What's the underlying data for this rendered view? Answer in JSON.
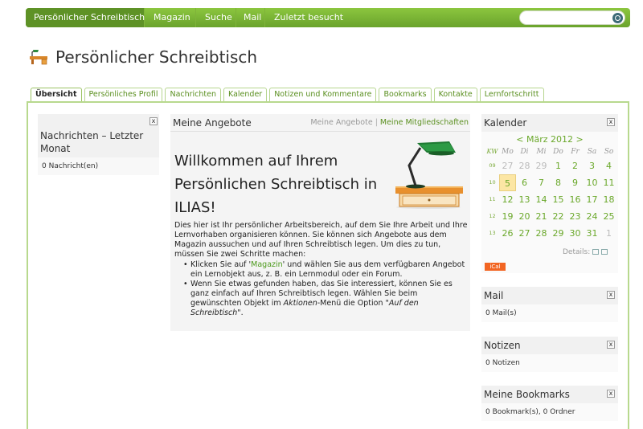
{
  "topnav": {
    "items": [
      {
        "label": "Persönlicher Schreibtisch",
        "active": true
      },
      {
        "label": "Magazin",
        "active": false
      },
      {
        "label": "Suche",
        "active": false
      },
      {
        "label": "Mail",
        "active": false
      },
      {
        "label": "Zuletzt besucht",
        "active": false
      }
    ],
    "search_placeholder": "",
    "search_icon": "magnifier-icon"
  },
  "page": {
    "title": "Persönlicher Schreibtisch",
    "icon": "desk-icon"
  },
  "tabs": [
    {
      "label": "Übersicht",
      "active": true
    },
    {
      "label": "Persönliches Profil",
      "active": false
    },
    {
      "label": "Nachrichten",
      "active": false
    },
    {
      "label": "Kalender",
      "active": false
    },
    {
      "label": "Notizen und Kommentare",
      "active": false
    },
    {
      "label": "Bookmarks",
      "active": false
    },
    {
      "label": "Kontakte",
      "active": false
    },
    {
      "label": "Lernfortschritt",
      "active": false
    }
  ],
  "left_panel": {
    "title": "Nachrichten – Letzter Monat",
    "close": "x",
    "body": "0 Nachricht(en)"
  },
  "center": {
    "title": "Meine Angebote",
    "link_offers": "Meine Angebote",
    "separator": "|",
    "link_memberships": "Meine Mitgliedschaften",
    "welcome": "Willkommen auf Ihrem Persönlichen Schreibtisch in ILIAS!",
    "intro": "Dies hier ist Ihr persönlicher Arbeitsbereich, auf dem Sie Ihre Arbeit und Ihre Lernvorhaben organisieren können. Sie können sich Angebote aus dem Magazin aussuchen und auf Ihren Schreibtisch legen. Um dies zu tun, müssen Sie zwei Schritte machen:",
    "step1_pre": "Klicken Sie auf '",
    "step1_link": "Magazin",
    "step1_post": "' und wählen Sie aus dem verfügbaren Angebot ein Lernobjekt aus, z. B. ein Lernmodul oder ein Forum.",
    "step2_pre": "Wenn Sie etwas gefunden haben, das Sie interessiert, können Sie es ganz einfach auf Ihren Schreibtisch legen. Wählen Sie beim gewünschten Objekt im ",
    "step2_menu": "Aktionen",
    "step2_mid": "-Menü die Option \"",
    "step2_option": "Auf den Schreibtisch",
    "step2_post": "\"."
  },
  "calendar": {
    "title": "Kalender",
    "close": "x",
    "month": "< März 2012 >",
    "headers": [
      "KW",
      "Mo",
      "Di",
      "Mi",
      "Do",
      "Fr",
      "Sa",
      "So"
    ],
    "weeks": [
      {
        "kw": "09",
        "days": [
          "27",
          "28",
          "29",
          "1",
          "2",
          "3",
          "4"
        ],
        "other": [
          true,
          true,
          true,
          false,
          false,
          false,
          false
        ]
      },
      {
        "kw": "10",
        "days": [
          "5",
          "6",
          "7",
          "8",
          "9",
          "10",
          "11"
        ],
        "other": [
          false,
          false,
          false,
          false,
          false,
          false,
          false
        ]
      },
      {
        "kw": "11",
        "days": [
          "12",
          "13",
          "14",
          "15",
          "16",
          "17",
          "18"
        ],
        "other": [
          false,
          false,
          false,
          false,
          false,
          false,
          false
        ]
      },
      {
        "kw": "12",
        "days": [
          "19",
          "20",
          "21",
          "22",
          "23",
          "24",
          "25"
        ],
        "other": [
          false,
          false,
          false,
          false,
          false,
          false,
          false
        ]
      },
      {
        "kw": "13",
        "days": [
          "26",
          "27",
          "28",
          "29",
          "30",
          "31",
          "1"
        ],
        "other": [
          false,
          false,
          false,
          false,
          false,
          false,
          true
        ]
      }
    ],
    "today": "5",
    "details_label": "Details:",
    "ical": "iCal"
  },
  "mail_panel": {
    "title": "Mail",
    "close": "x",
    "body": "0 Mail(s)"
  },
  "notes_panel": {
    "title": "Notizen",
    "close": "x",
    "body": "0 Notizen"
  },
  "bookmarks_panel": {
    "title": "Meine Bookmarks",
    "close": "x",
    "body": "0 Bookmark(s), 0 Ordner"
  },
  "colors": {
    "accent": "#6aa32c",
    "link": "#5a8f1f",
    "today": "#fce6a4",
    "ical": "#f26522"
  }
}
